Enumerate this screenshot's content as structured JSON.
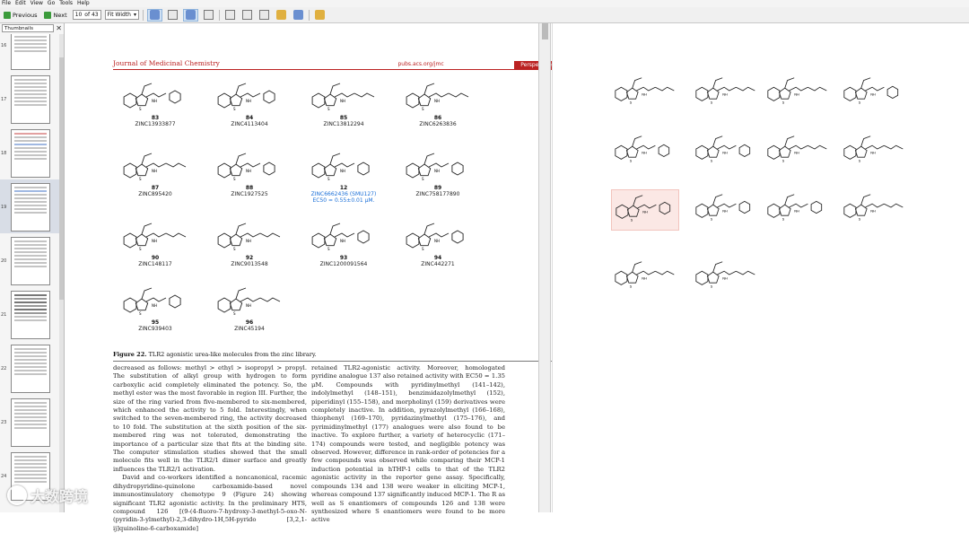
{
  "menu": [
    "File",
    "Edit",
    "View",
    "Go",
    "Tools",
    "Help"
  ],
  "toolbar": {
    "previous": "Previous",
    "next": "Next",
    "page_value": "10",
    "page_total": "of 43",
    "zoom": "Fit Width"
  },
  "sidebar": {
    "combo": "Thumbnails",
    "pages": [
      "16",
      "17",
      "18",
      "19",
      "20",
      "21",
      "22",
      "23",
      "24"
    ],
    "selected_page": "19"
  },
  "document": {
    "journal": "Journal of Medicinal Chemistry",
    "url": "pubs.acs.org/jmc",
    "tag": "Perspective",
    "figure_label": "Figure 22.",
    "figure_caption": "TLR2 agonistic urea-like molecules from the zinc library.",
    "compounds": [
      {
        "num": "83",
        "zinc": "ZINC13933877"
      },
      {
        "num": "84",
        "zinc": "ZINC4113404"
      },
      {
        "num": "85",
        "zinc": "ZINC13812294"
      },
      {
        "num": "86",
        "zinc": "ZINC6263836"
      },
      {
        "num": "87",
        "zinc": "ZINC895420"
      },
      {
        "num": "88",
        "zinc": "ZINC1927525"
      },
      {
        "num": "12",
        "zinc": "ZINC6662436 (SMU127)",
        "ec": "EC50 = 0.55±0.01 μM."
      },
      {
        "num": "89",
        "zinc": "ZINC758177890"
      },
      {
        "num": "90",
        "zinc": "ZINC148117"
      },
      {
        "num": "92",
        "zinc": "ZINC9013548"
      },
      {
        "num": "93",
        "zinc": "ZINC1200091564"
      },
      {
        "num": "94",
        "zinc": "ZINC442271"
      },
      {
        "num": "95",
        "zinc": "ZINC939403"
      },
      {
        "num": "96",
        "zinc": "ZINC45194"
      }
    ],
    "left_column": "decreased as follows: methyl > ethyl > isopropyl > propyl. The substitution of alkyl group with hydrogen to form carboxylic acid completely eliminated the potency. So, the methyl ester was the most favorable in region III. Further, the size of the ring varied from five-membered to six-membered, which enhanced the activity to 5 fold. Interestingly, when switched to the seven-membered ring, the activity decreased to 10 fold. The substitution at the sixth position of the six-membered ring was not tolerated, demonstrating the importance of a particular size that fits at the binding site. The computer stimulation studies showed that the small molecule fits well in the TLR2/1 dimer surface and greatly influences the TLR2/1 activation.",
    "left_column_2": "David and co-workers identified a noncanonical, racemic dihydropyridine-quinolone carboxamide-based novel immunostimulatory chemotype 9 (Figure 24) showing significant TLR2 agonistic activity. In the preliminary HTS, compound 126 [(9-(4-fluoro-7-hydroxy-3-methyl-5-oxo-N-(pyridin-3-ylmethyl)-2,3-dihydro-1H,5H-pyrido [3,2,1-ij]quinoline-6-carboxamide]",
    "right_column": "retained TLR2-agonistic activity. Moreover, homologated pyridine analogue 137 also retained activity with EC50 = 1.35 μM. Compounds with pyridinylmethyl (141–142), indolylmethyl (148–151), benzimidazolylmethyl (152), piperidinyl (155–158), and morpholinyl (159) derivatives were completely inactive. In addition, pyrazolylmethyl (166–168), thiophenyl (169–170), pyridazinylmethyl (175–176), and pyrimidinylmethyl (177) analogues were also found to be inactive. To explore further, a variety of heterocyclic (171–174) compounds were tested, and negligible potency was observed. However, difference in rank-order of potencies for a few compounds was observed while comparing their MCP-1 induction potential in hTHP-1 cells to that of the TLR2 agonistic activity in the reporter gene assay. Specifically, compounds 134 and 138 were weaker in eliciting MCP-1, whereas compound 137 significantly induced MCP-1. The R as well as S enantiomers of compounds 126 and 138 were synthesized where S enantiomers were found to be more active"
  },
  "watermark": "大数跨境",
  "colors": {
    "journal_red": "#b22222",
    "link_blue": "#1a6fd8",
    "highlight": "#fbe8e5"
  }
}
